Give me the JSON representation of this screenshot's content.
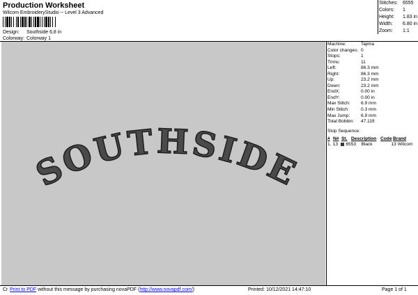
{
  "header": {
    "title": "Production Worksheet",
    "subtitle": "Wilcom EmbroideryStudio -- Level 3 Advanced"
  },
  "design_info": {
    "design_label": "Design:",
    "design_value": "Southside 6,8 in",
    "colorway_label": "Colorway:",
    "colorway_value": "Colorway 1"
  },
  "stats": [
    {
      "label": "Stitches:",
      "value": "6555"
    },
    {
      "label": "Colors:",
      "value": "1"
    },
    {
      "label": "Height:",
      "value": "1.83 in"
    },
    {
      "label": "Width:",
      "value": "6.80 in"
    },
    {
      "label": "Zoom:",
      "value": "1:1"
    }
  ],
  "design_text": "SOUTHSIDE",
  "params": [
    {
      "label": "Machine:",
      "value": "Tajima"
    },
    {
      "label": "Color changes:",
      "value": "0"
    },
    {
      "label": "Stops:",
      "value": "1"
    },
    {
      "label": "Trims:",
      "value": "11"
    },
    {
      "label": "Left:",
      "value": "86.3 mm"
    },
    {
      "label": "Right:",
      "value": "86.3 mm"
    },
    {
      "label": "Up:",
      "value": "23.2 mm"
    },
    {
      "label": "Down:",
      "value": "23.2 mm"
    },
    {
      "label": "EndX:",
      "value": "0.00 in"
    },
    {
      "label": "EndY:",
      "value": "0.00 in"
    },
    {
      "label": "Max Stitch:",
      "value": "6.9 mm"
    },
    {
      "label": "Min Stitch:",
      "value": "0.3 mm"
    },
    {
      "label": "Max Jump:",
      "value": "6.9 mm"
    },
    {
      "label": "Total Bobbin:",
      "value": "47.11ft"
    }
  ],
  "stop_sequence": {
    "title": "Stop Sequence:",
    "headers": [
      "#",
      "N#",
      "St.",
      "Description",
      "Code",
      "Brand"
    ],
    "rows": [
      {
        "num": "1.",
        "n": "13",
        "st": "6553",
        "description": "Black",
        "code": "13",
        "brand": "Wilcom",
        "color": "#3a3a3a"
      }
    ]
  },
  "footer": {
    "prefix": "Cr",
    "link_text": "Print to PDF",
    "middle_text": " without this message by purchasing novaPDF (",
    "url_text": "http://www.novapdf.com/",
    "suffix": ")",
    "printed": "Printed: 10/12/2021 14:47:10",
    "page": "Page 1 of 1"
  },
  "colors": {
    "design_bg": "#c8c8c8",
    "thread": "#3a3a3a"
  }
}
